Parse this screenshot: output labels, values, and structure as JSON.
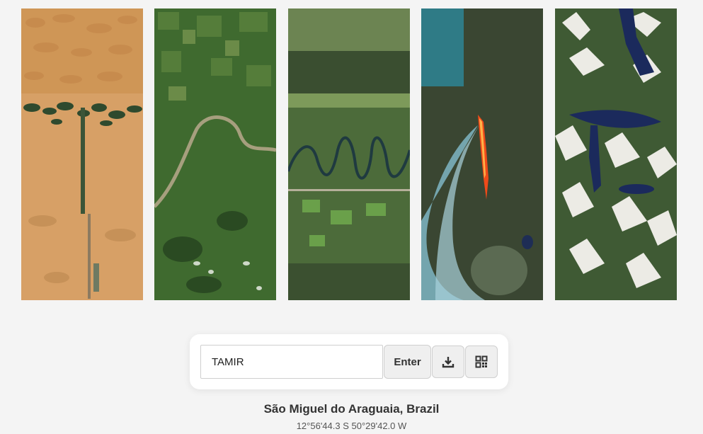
{
  "tiles": [
    {
      "name": "desert-oasis-tile"
    },
    {
      "name": "farmland-river-tile"
    },
    {
      "name": "meandering-river-tile"
    },
    {
      "name": "wildfire-smoke-tile"
    },
    {
      "name": "snowy-mountains-lakes-tile"
    }
  ],
  "form": {
    "input_value": "TAMIR",
    "enter_label": "Enter",
    "download_icon": "download-icon",
    "qr_icon": "qr-code-icon"
  },
  "location": {
    "name": "São Miguel do Araguaia, Brazil",
    "coordinates": "12°56'44.3 S 50°29'42.0 W"
  }
}
